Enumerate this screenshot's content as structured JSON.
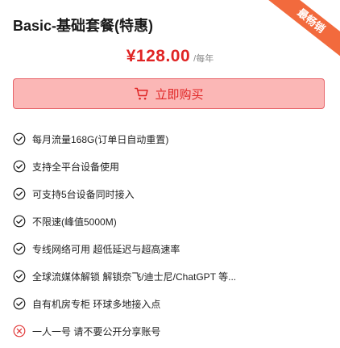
{
  "plan": {
    "title": "Basic-基础套餐(特惠)",
    "ribbon": "最畅销",
    "price": "¥128.00",
    "unit": "/每年",
    "buy_label": "立即购买"
  },
  "features": [
    {
      "text": "每月流量168G(订单日自动重置)",
      "icon": "check-circle-icon"
    },
    {
      "text": "支持全平台设备使用",
      "icon": "check-circle-icon"
    },
    {
      "text": "可支持5台设备同时接入",
      "icon": "check-circle-icon"
    },
    {
      "text": "不限速(峰值5000M)",
      "icon": "check-circle-icon"
    },
    {
      "text": "专线网络可用 超低延迟与超高速率",
      "icon": "check-circle-icon"
    },
    {
      "text": "全球流媒体解锁 解锁奈飞/迪士尼/ChatGPT 等...",
      "icon": "check-circle-icon"
    },
    {
      "text": "自有机房专柜 环球多地接入点",
      "icon": "check-circle-icon"
    },
    {
      "text": "一人一号 请不要公开分享账号",
      "icon": "x-circle-icon"
    }
  ],
  "colors": {
    "accent": "#e02424",
    "check": "#1a1a1a",
    "cross": "#e23b3b",
    "ribbon": "#f26a3d",
    "button_bg": "#fbb7b6"
  }
}
